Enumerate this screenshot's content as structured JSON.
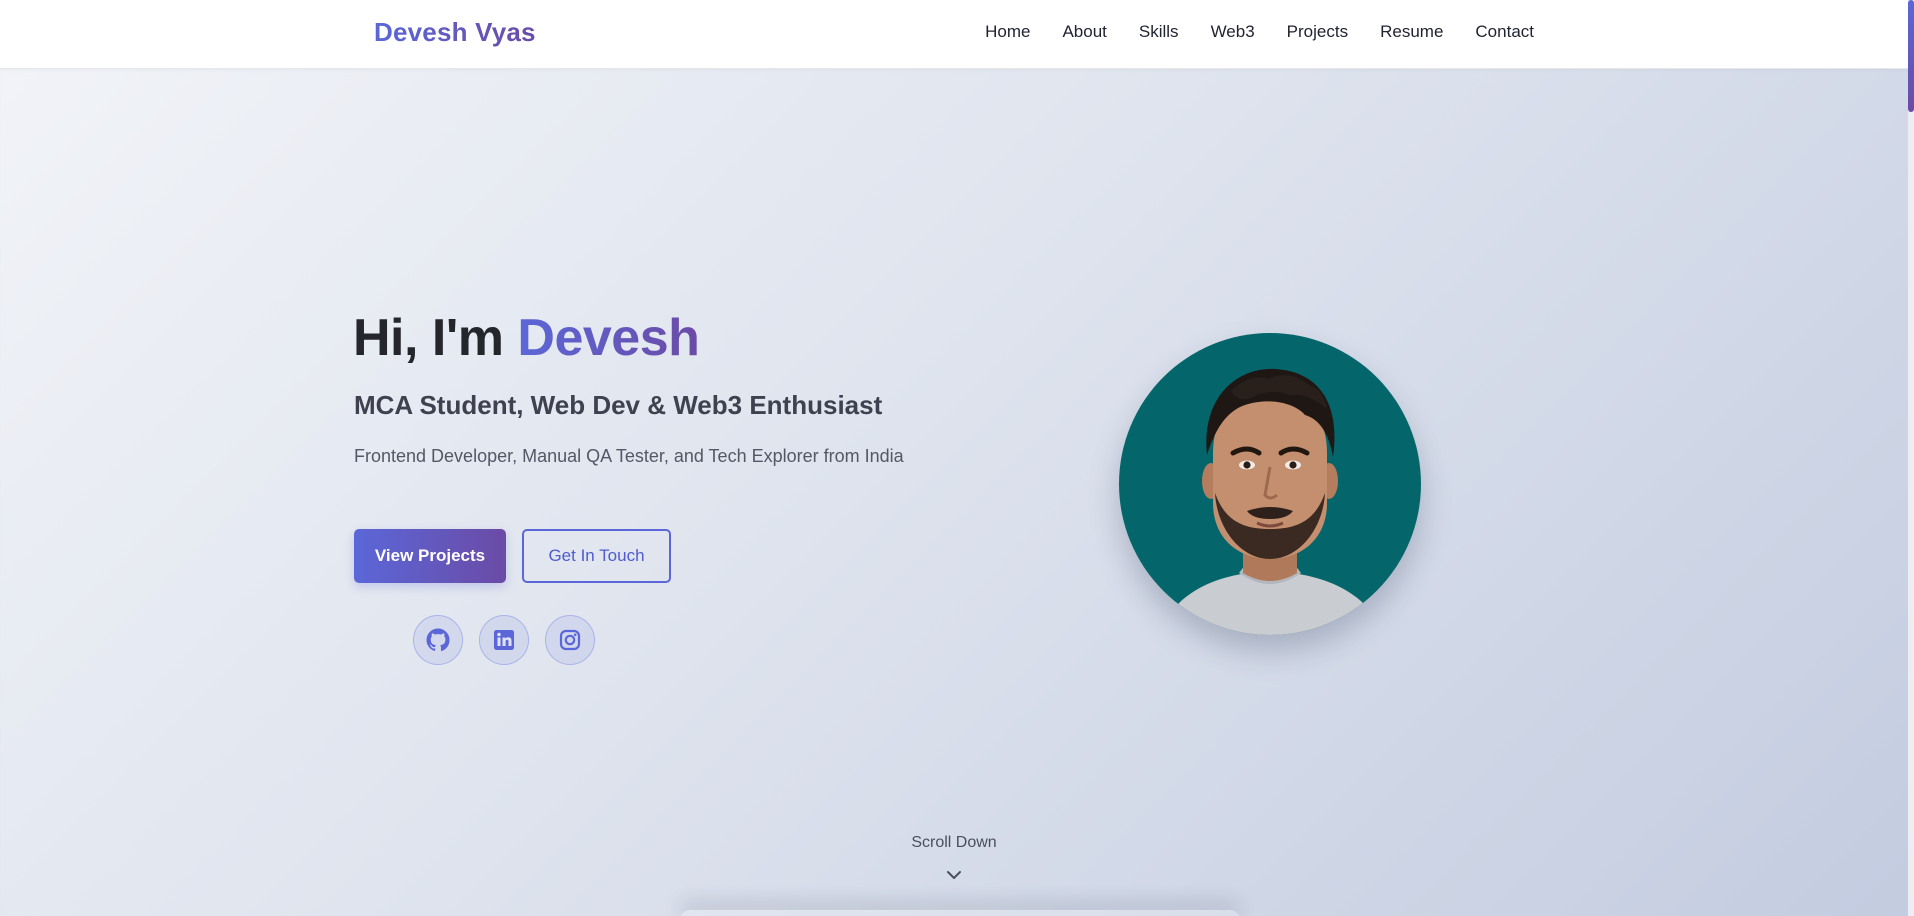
{
  "nav": {
    "brand": "Devesh Vyas",
    "links": [
      "Home",
      "About",
      "Skills",
      "Web3",
      "Projects",
      "Resume",
      "Contact"
    ]
  },
  "hero": {
    "greeting": "Hi, I'm",
    "name": "Devesh",
    "subtitle": "MCA Student, Web Dev & Web3 Enthusiast",
    "description": "Frontend Developer, Manual QA Tester, and Tech Explorer from India",
    "primary_button": "View Projects",
    "secondary_button": "Get In Touch",
    "socials": [
      "github-icon",
      "linkedin-icon",
      "instagram-icon"
    ]
  },
  "scroll": {
    "label": "Scroll Down"
  },
  "colors": {
    "accent_start": "#5b67d8",
    "accent_end": "#6b4ba6",
    "avatar_bg": "#04666a"
  }
}
